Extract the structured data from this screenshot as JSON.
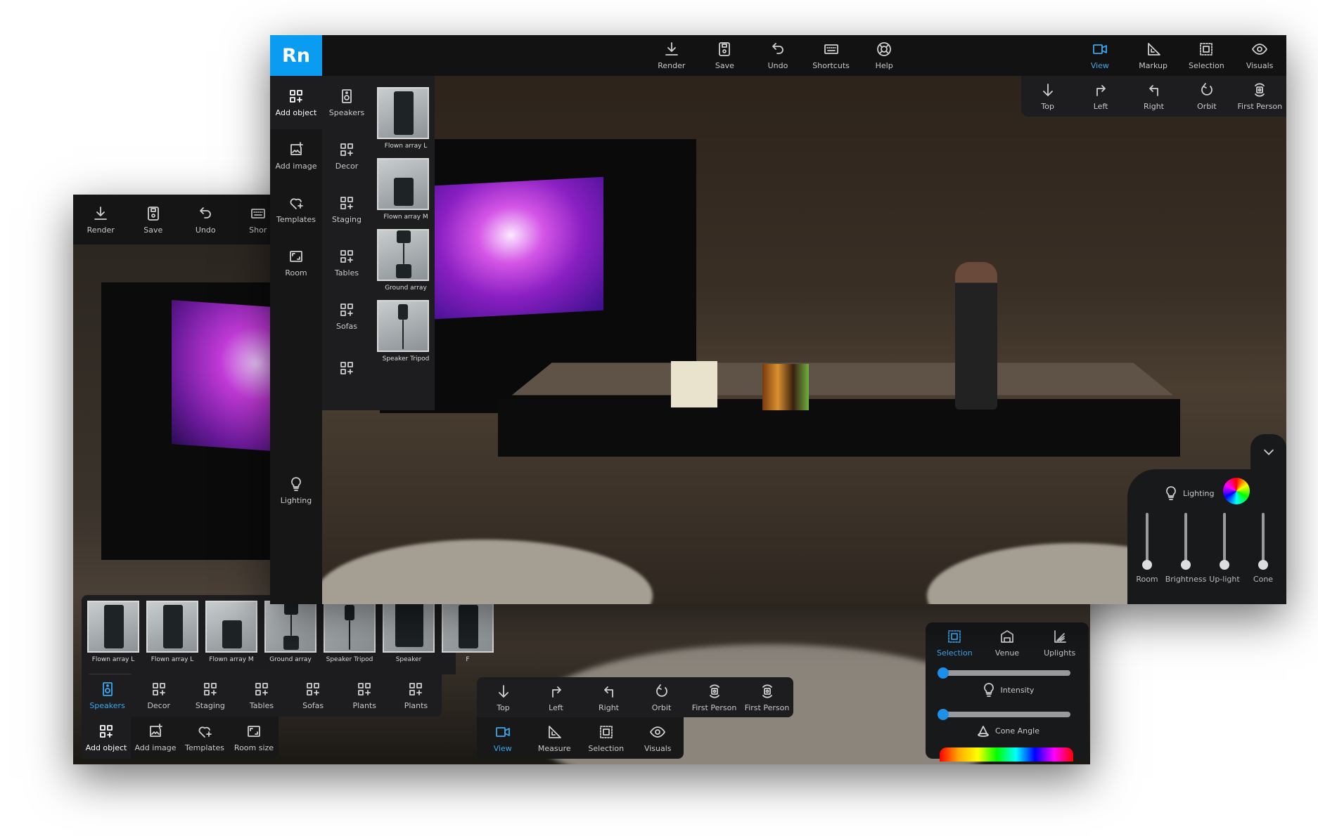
{
  "app": {
    "logo": "Rn",
    "accent": "#0a9cf0",
    "active_color": "#3aa8ee"
  },
  "front": {
    "toolbar": [
      {
        "label": "Render",
        "icon": "download"
      },
      {
        "label": "Save",
        "icon": "save"
      },
      {
        "label": "Undo",
        "icon": "undo"
      },
      {
        "label": "Shortcuts",
        "icon": "keyboard"
      },
      {
        "label": "Help",
        "icon": "help"
      }
    ],
    "modes": [
      {
        "label": "View",
        "icon": "video",
        "active": true
      },
      {
        "label": "Markup",
        "icon": "ruler"
      },
      {
        "label": "Selection",
        "icon": "selection"
      },
      {
        "label": "Visuals",
        "icon": "eye"
      }
    ],
    "camera": [
      {
        "label": "Top",
        "icon": "arrow-down"
      },
      {
        "label": "Left",
        "icon": "turn-right"
      },
      {
        "label": "Right",
        "icon": "turn-left"
      },
      {
        "label": "Orbit",
        "icon": "orbit"
      },
      {
        "label": "First Person",
        "icon": "first-person"
      }
    ],
    "sidebar": [
      {
        "label": "Add object",
        "icon": "grid-plus",
        "bright": true
      },
      {
        "label": "Add image",
        "icon": "image-add"
      },
      {
        "label": "Templates",
        "icon": "heart-plus"
      },
      {
        "label": "Room",
        "icon": "room"
      }
    ],
    "lighting_button": {
      "label": "Lighting",
      "icon": "bulb"
    },
    "categories": [
      {
        "label": "Speakers",
        "icon": "speaker"
      },
      {
        "label": "Decor",
        "icon": "grid-plus"
      },
      {
        "label": "Staging",
        "icon": "grid-plus"
      },
      {
        "label": "Tables",
        "icon": "grid-plus"
      },
      {
        "label": "Sofas",
        "icon": "grid-plus"
      },
      {
        "label": "",
        "icon": "grid-plus"
      }
    ],
    "products": [
      {
        "label": "Flown array L",
        "kind": "tall"
      },
      {
        "label": "Flown array M",
        "kind": "mid"
      },
      {
        "label": "Ground array",
        "kind": "pole"
      },
      {
        "label": "Speaker Tripod",
        "kind": "tripod"
      }
    ],
    "lighting_panel": {
      "title": "Lighting",
      "sliders": [
        {
          "label": "Room",
          "value": 0
        },
        {
          "label": "Brightness",
          "value": 0
        },
        {
          "label": "Up-light",
          "value": 0
        },
        {
          "label": "Cone",
          "value": 0
        }
      ]
    }
  },
  "back": {
    "toolbar": [
      {
        "label": "Render",
        "icon": "download"
      },
      {
        "label": "Save",
        "icon": "save"
      },
      {
        "label": "Undo",
        "icon": "undo"
      },
      {
        "label": "Shor",
        "icon": "keyboard"
      }
    ],
    "products": [
      {
        "label": "Flown array L",
        "kind": "tall"
      },
      {
        "label": "Flown array L",
        "kind": "tall"
      },
      {
        "label": "Flown array M",
        "kind": "mid"
      },
      {
        "label": "Ground array",
        "kind": "pole"
      },
      {
        "label": "Speaker Tripod",
        "kind": "tripod"
      },
      {
        "label": "Speaker",
        "kind": "box"
      },
      {
        "label": "F",
        "kind": "tall"
      }
    ],
    "categories": [
      {
        "label": "Speakers",
        "icon": "speaker",
        "active": true
      },
      {
        "label": "Decor",
        "icon": "grid-plus"
      },
      {
        "label": "Staging",
        "icon": "grid-plus"
      },
      {
        "label": "Tables",
        "icon": "grid-plus"
      },
      {
        "label": "Sofas",
        "icon": "grid-plus"
      },
      {
        "label": "Plants",
        "icon": "grid-plus"
      },
      {
        "label": "Plants",
        "icon": "grid-plus"
      }
    ],
    "main_tools": [
      {
        "label": "Add object",
        "icon": "grid-plus",
        "bright": true
      },
      {
        "label": "Add image",
        "icon": "image-add"
      },
      {
        "label": "Templates",
        "icon": "heart-plus"
      },
      {
        "label": "Room size",
        "icon": "room"
      }
    ],
    "camera": [
      {
        "label": "Top",
        "icon": "arrow-down"
      },
      {
        "label": "Left",
        "icon": "turn-right"
      },
      {
        "label": "Right",
        "icon": "turn-left"
      },
      {
        "label": "Orbit",
        "icon": "orbit"
      },
      {
        "label": "First Person",
        "icon": "first-person"
      },
      {
        "label": "First Person",
        "icon": "first-person"
      }
    ],
    "modes": [
      {
        "label": "View",
        "icon": "video",
        "active": true
      },
      {
        "label": "Measure",
        "icon": "ruler"
      },
      {
        "label": "Selection",
        "icon": "selection"
      },
      {
        "label": "Visuals",
        "icon": "eye"
      }
    ],
    "light_tabs": [
      {
        "label": "Selection",
        "icon": "selection",
        "active": true
      },
      {
        "label": "Venue",
        "icon": "venue"
      },
      {
        "label": "Uplights",
        "icon": "uplights"
      }
    ],
    "intensity": {
      "label": "Intensity",
      "value": 0
    },
    "cone_angle": {
      "label": "Cone Angle",
      "value": 0
    }
  }
}
